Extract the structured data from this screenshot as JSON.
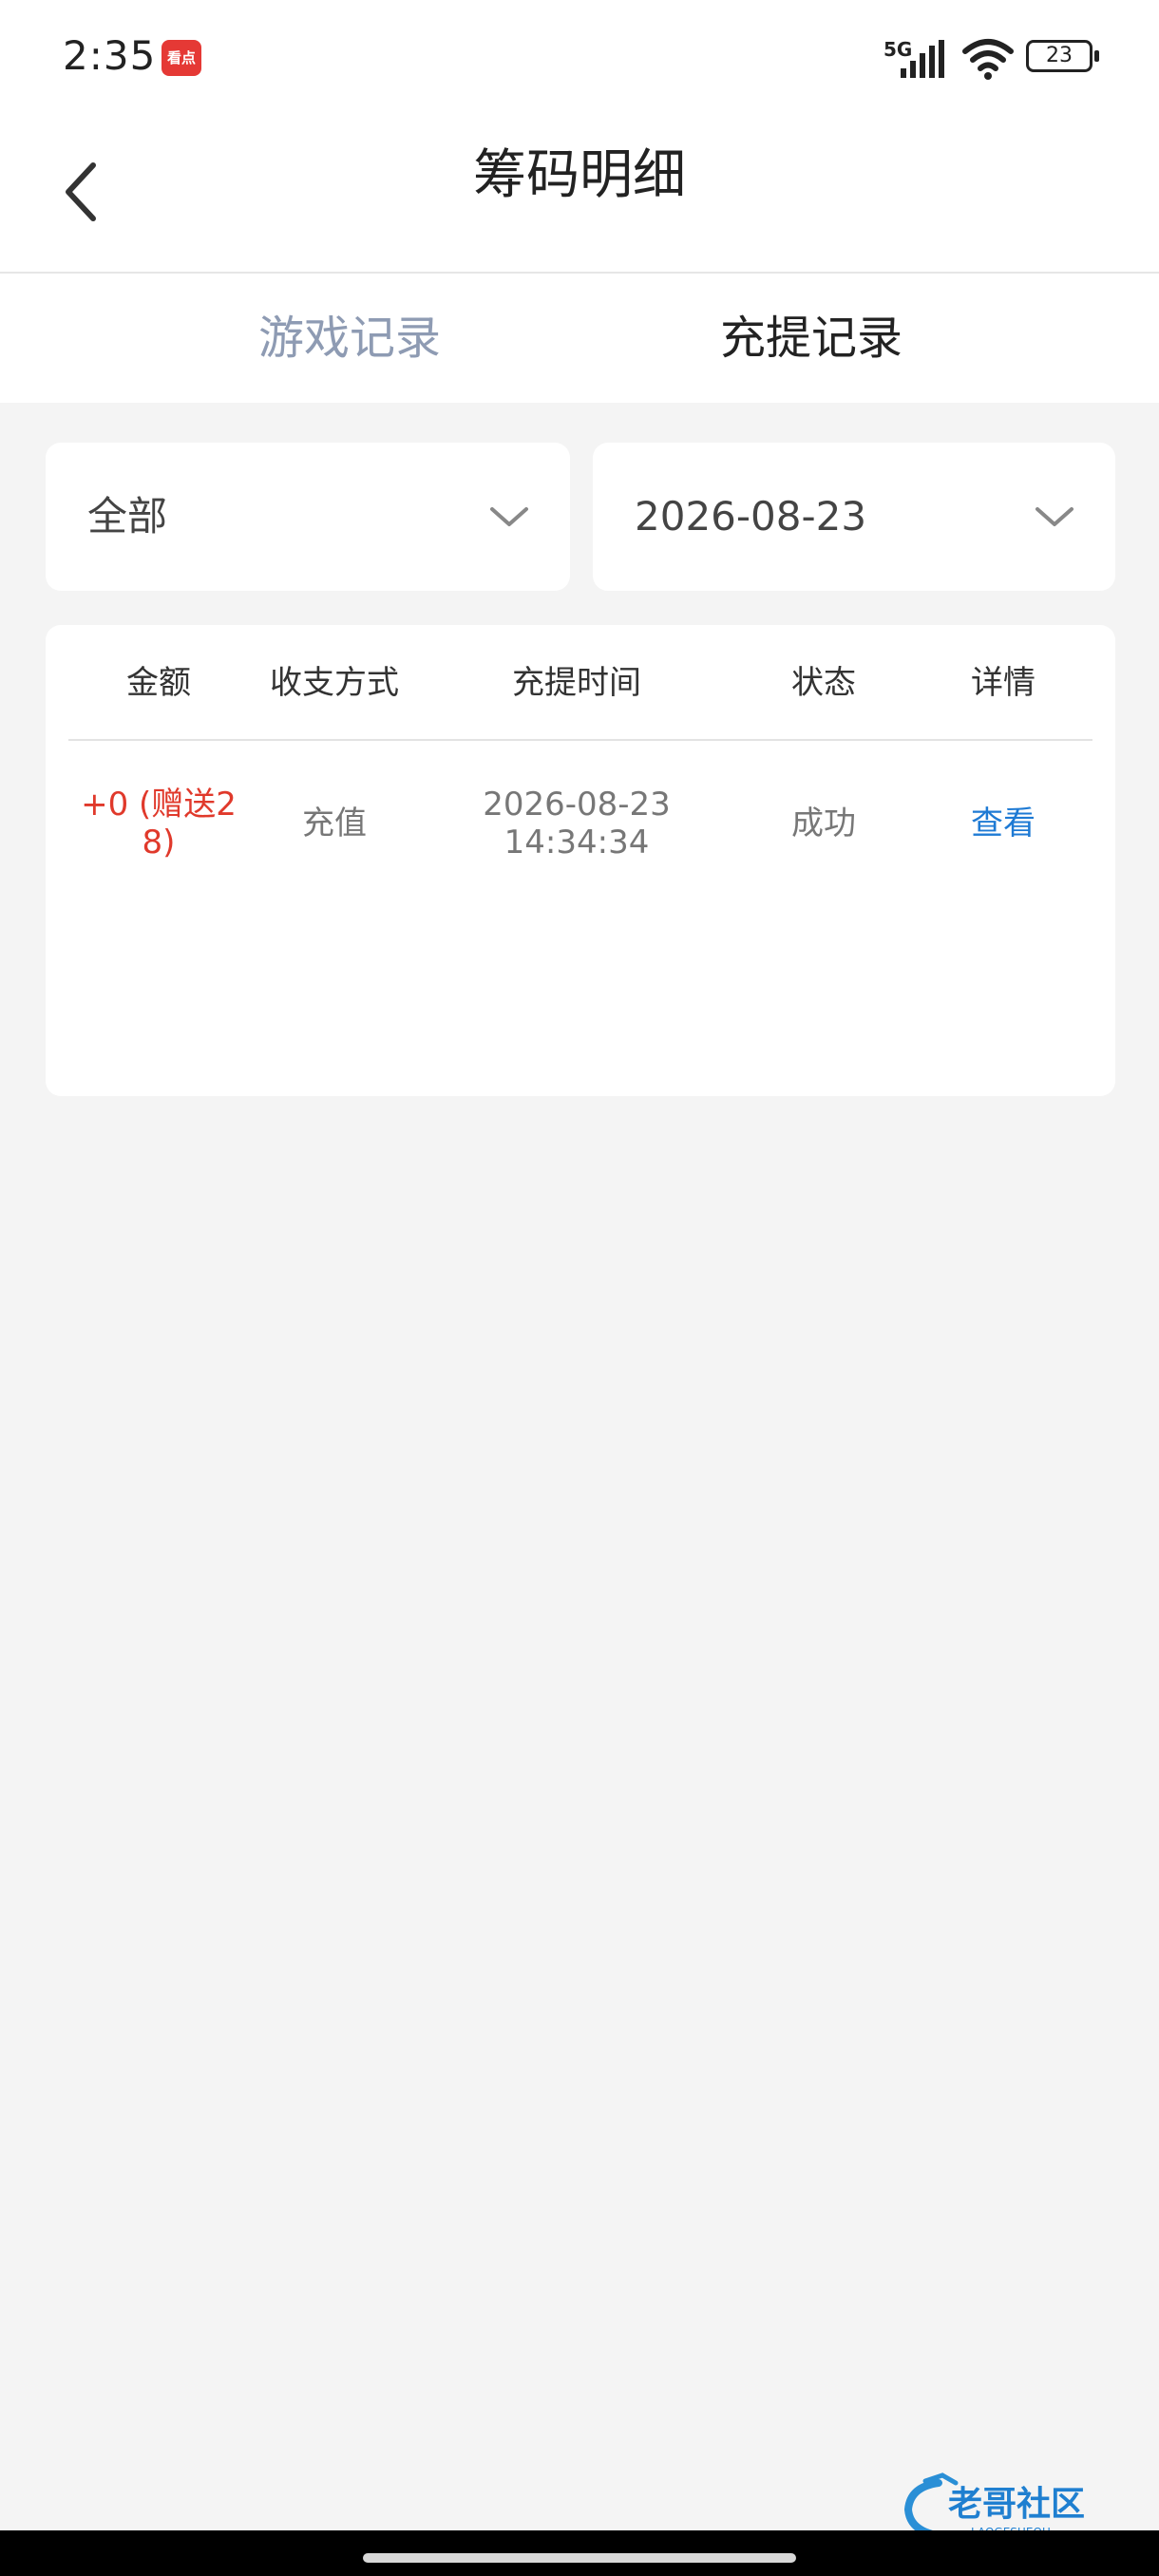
{
  "status_bar": {
    "time": "2:35",
    "notification_app_label": "看点",
    "network": "5G",
    "battery": "23"
  },
  "header": {
    "title": "筹码明细"
  },
  "tabs": [
    {
      "label": "游戏记录",
      "active": false
    },
    {
      "label": "充提记录",
      "active": true
    }
  ],
  "filters": {
    "type_value": "全部",
    "date_value": "2026-08-23"
  },
  "table": {
    "columns": [
      "金额",
      "收支方式",
      "充提时间",
      "状态",
      "详情"
    ],
    "rows": [
      {
        "amount_line1": "+0 (赠送2",
        "amount_line2": "8)",
        "method": "充值",
        "time_date": "2026-08-23",
        "time_clock": "14:34:34",
        "status": "成功",
        "detail": "查看"
      }
    ]
  },
  "watermark": {
    "text": "老哥社区",
    "subtext": "LAOGESHEQU"
  },
  "colors": {
    "accent_red": "#e0392b",
    "link_blue": "#1e7ad4",
    "inactive_tab": "#8e9bb3",
    "page_bg": "#f4f4f4"
  }
}
